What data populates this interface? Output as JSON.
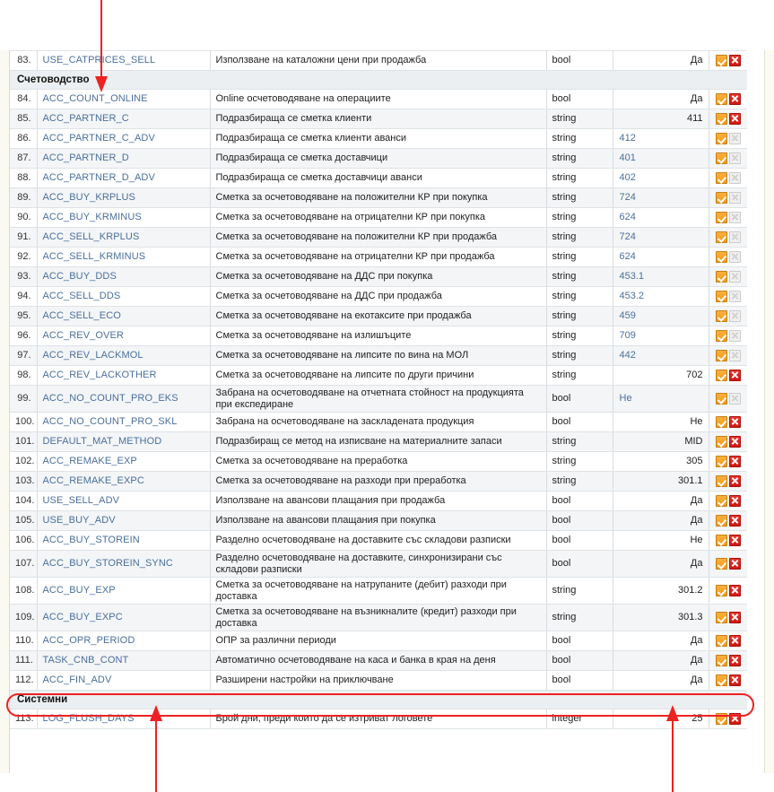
{
  "colors": {
    "link": "#4a6f9c",
    "annotation": "#ee2222",
    "icon_check": "#f59a14",
    "icon_x": "#cc1a12",
    "zebra": "#f3f5f7",
    "section_header_bg": "#eceff1"
  },
  "columns": {
    "num": "",
    "key": "",
    "description": "",
    "type": "",
    "value": "",
    "actions": ""
  },
  "icons": {
    "check": "checkbox-checked-icon",
    "delete": "delete-x-icon",
    "delete_disabled": "delete-x-disabled-icon"
  },
  "sections": [
    {
      "kind": "rows",
      "rows": [
        {
          "num": "83.",
          "key": "USE_CATPRICES_SELL",
          "desc": "Използване на каталожни цени при продажба",
          "type": "bool",
          "value": "Да",
          "align": "right",
          "delete_enabled": true,
          "zebra": false,
          "tall": false
        }
      ]
    },
    {
      "kind": "header",
      "title": "Счетоводство"
    },
    {
      "kind": "rows",
      "rows": [
        {
          "num": "84.",
          "key": "ACC_COUNT_ONLINE",
          "desc": "Online осчетоводяване на операциите",
          "type": "bool",
          "value": "Да",
          "align": "right",
          "delete_enabled": true,
          "zebra": false,
          "tall": false
        },
        {
          "num": "85.",
          "key": "ACC_PARTNER_C",
          "desc": "Подразбираща се сметка клиенти",
          "type": "string",
          "value": "411",
          "align": "right",
          "delete_enabled": true,
          "zebra": true,
          "tall": false
        },
        {
          "num": "86.",
          "key": "ACC_PARTNER_C_ADV",
          "desc": "Подразбираща се сметка клиенти аванси",
          "type": "string",
          "value": "412",
          "align": "left",
          "delete_enabled": false,
          "zebra": false,
          "tall": false
        },
        {
          "num": "87.",
          "key": "ACC_PARTNER_D",
          "desc": "Подразбираща се сметка доставчици",
          "type": "string",
          "value": "401",
          "align": "left",
          "delete_enabled": false,
          "zebra": true,
          "tall": false
        },
        {
          "num": "88.",
          "key": "ACC_PARTNER_D_ADV",
          "desc": "Подразбираща се сметка доставчици аванси",
          "type": "string",
          "value": "402",
          "align": "left",
          "delete_enabled": false,
          "zebra": false,
          "tall": false
        },
        {
          "num": "89.",
          "key": "ACC_BUY_KRPLUS",
          "desc": "Сметка за осчетоводяване на положителни КР при покупка",
          "type": "string",
          "value": "724",
          "align": "left",
          "delete_enabled": false,
          "zebra": true,
          "tall": false
        },
        {
          "num": "90.",
          "key": "ACC_BUY_KRMINUS",
          "desc": "Сметка за осчетоводяване на отрицателни КР при покупка",
          "type": "string",
          "value": "624",
          "align": "left",
          "delete_enabled": false,
          "zebra": false,
          "tall": false
        },
        {
          "num": "91.",
          "key": "ACC_SELL_KRPLUS",
          "desc": "Сметка за осчетоводяване на положителни КР при продажба",
          "type": "string",
          "value": "724",
          "align": "left",
          "delete_enabled": false,
          "zebra": true,
          "tall": false
        },
        {
          "num": "92.",
          "key": "ACC_SELL_KRMINUS",
          "desc": "Сметка за осчетоводяване на отрицателни КР при продажба",
          "type": "string",
          "value": "624",
          "align": "left",
          "delete_enabled": false,
          "zebra": false,
          "tall": false
        },
        {
          "num": "93.",
          "key": "ACC_BUY_DDS",
          "desc": "Сметка за осчетоводяване на ДДС при покупка",
          "type": "string",
          "value": "453.1",
          "align": "left",
          "delete_enabled": false,
          "zebra": true,
          "tall": false
        },
        {
          "num": "94.",
          "key": "ACC_SELL_DDS",
          "desc": "Сметка за осчетоводяване на ДДС при продажба",
          "type": "string",
          "value": "453.2",
          "align": "left",
          "delete_enabled": false,
          "zebra": false,
          "tall": false
        },
        {
          "num": "95.",
          "key": "ACC_SELL_ECO",
          "desc": "Сметка за осчетоводяване на екотаксите при продажба",
          "type": "string",
          "value": "459",
          "align": "left",
          "delete_enabled": false,
          "zebra": true,
          "tall": false
        },
        {
          "num": "96.",
          "key": "ACC_REV_OVER",
          "desc": "Сметка за осчетоводяване на излишъците",
          "type": "string",
          "value": "709",
          "align": "left",
          "delete_enabled": false,
          "zebra": false,
          "tall": false
        },
        {
          "num": "97.",
          "key": "ACC_REV_LACKMOL",
          "desc": "Сметка за осчетоводяване на липсите по вина на МОЛ",
          "type": "string",
          "value": "442",
          "align": "left",
          "delete_enabled": false,
          "zebra": true,
          "tall": false
        },
        {
          "num": "98.",
          "key": "ACC_REV_LACKOTHER",
          "desc": "Сметка за осчетоводяване на липсите по други причини",
          "type": "string",
          "value": "702",
          "align": "right",
          "delete_enabled": true,
          "zebra": false,
          "tall": false
        },
        {
          "num": "99.",
          "key": "ACC_NO_COUNT_PRO_EKS",
          "desc": "Забрана на осчетоводяване на отчетната стойност на продукцията при експедиране",
          "type": "bool",
          "value": "Не",
          "align": "left",
          "delete_enabled": false,
          "zebra": true,
          "tall": true
        },
        {
          "num": "100.",
          "key": "ACC_NO_COUNT_PRO_SKL",
          "desc": "Забрана на осчетоводяване на заскладената продукция",
          "type": "bool",
          "value": "Не",
          "align": "right",
          "delete_enabled": true,
          "zebra": false,
          "tall": false
        },
        {
          "num": "101.",
          "key": "DEFAULT_MAT_METHOD",
          "desc": "Подразбиращ се метод на изписване на материалните запаси",
          "type": "string",
          "value": "MID",
          "align": "right",
          "delete_enabled": true,
          "zebra": true,
          "tall": false
        },
        {
          "num": "102.",
          "key": "ACC_REMAKE_EXP",
          "desc": "Сметка за осчетоводяване на преработка",
          "type": "string",
          "value": "305",
          "align": "right",
          "delete_enabled": true,
          "zebra": false,
          "tall": false
        },
        {
          "num": "103.",
          "key": "ACC_REMAKE_EXPC",
          "desc": "Сметка за осчетоводяване на разходи при преработка",
          "type": "string",
          "value": "301.1",
          "align": "right",
          "delete_enabled": true,
          "zebra": true,
          "tall": false
        },
        {
          "num": "104.",
          "key": "USE_SELL_ADV",
          "desc": "Използване на авансови плащания при продажба",
          "type": "bool",
          "value": "Да",
          "align": "right",
          "delete_enabled": true,
          "zebra": false,
          "tall": false
        },
        {
          "num": "105.",
          "key": "USE_BUY_ADV",
          "desc": "Използване на авансови плащания при покупка",
          "type": "bool",
          "value": "Да",
          "align": "right",
          "delete_enabled": true,
          "zebra": true,
          "tall": false
        },
        {
          "num": "106.",
          "key": "ACC_BUY_STOREIN",
          "desc": "Разделно осчетоводяване на доставките със складови разписки",
          "type": "bool",
          "value": "Не",
          "align": "right",
          "delete_enabled": true,
          "zebra": false,
          "tall": false
        },
        {
          "num": "107.",
          "key": "ACC_BUY_STOREIN_SYNC",
          "desc": "Разделно осчетоводяване на доставките, синхронизирани със складови разписки",
          "type": "bool",
          "value": "Да",
          "align": "right",
          "delete_enabled": true,
          "zebra": true,
          "tall": true
        },
        {
          "num": "108.",
          "key": "ACC_BUY_EXP",
          "desc": "Сметка за осчетоводяване на натрупаните (дебит) разходи при доставка",
          "type": "string",
          "value": "301.2",
          "align": "right",
          "delete_enabled": true,
          "zebra": false,
          "tall": true
        },
        {
          "num": "109.",
          "key": "ACC_BUY_EXPC",
          "desc": "Сметка за осчетоводяване на възникналите (кредит) разходи при доставка",
          "type": "string",
          "value": "301.3",
          "align": "right",
          "delete_enabled": true,
          "zebra": true,
          "tall": true
        },
        {
          "num": "110.",
          "key": "ACC_OPR_PERIOD",
          "desc": "ОПР за различни периоди",
          "type": "bool",
          "value": "Да",
          "align": "right",
          "delete_enabled": true,
          "zebra": false,
          "tall": false
        },
        {
          "num": "111.",
          "key": "TASK_CNB_CONT",
          "desc": "Автоматично осчетоводяване на каса и банка в края на деня",
          "type": "bool",
          "value": "Да",
          "align": "right",
          "delete_enabled": true,
          "zebra": true,
          "tall": false
        },
        {
          "num": "112.",
          "key": "ACC_FIN_ADV",
          "desc": "Разширени настройки на приключване",
          "type": "bool",
          "value": "Да",
          "align": "right",
          "delete_enabled": true,
          "zebra": false,
          "tall": false,
          "highlighted": true
        }
      ]
    },
    {
      "kind": "header",
      "title": "Системни"
    },
    {
      "kind": "rows",
      "rows": [
        {
          "num": "113.",
          "key": "LOG_FLUSH_DAYS",
          "desc": "Брой дни, преди които да се изтриват логовете",
          "type": "integer",
          "value": "25",
          "align": "right",
          "delete_enabled": true,
          "zebra": false,
          "tall": false
        }
      ]
    }
  ],
  "annotations": {
    "top_pointer_label": "",
    "highlight_row_key": "ACC_FIN_ADV",
    "arrow_count": 3
  }
}
